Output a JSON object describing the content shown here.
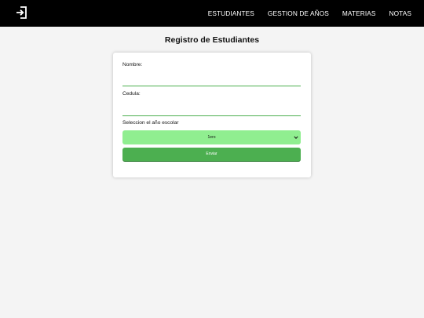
{
  "nav": {
    "logout_icon": "logout-icon",
    "links": [
      "ESTUDIANTES",
      "GESTION DE AÑOS",
      "MATERIAS",
      "NOTAS"
    ]
  },
  "page": {
    "title": "Registro de Estudiantes"
  },
  "form": {
    "nombre_label": "Nombre:",
    "nombre_value": "",
    "cedula_label": "Cedula:",
    "cedula_value": "",
    "year_label": "Seleccion el año escolar",
    "year_selected": "1ero",
    "submit_label": "Enviar"
  },
  "colors": {
    "navbar": "#000000",
    "accent": "#4caf50",
    "select_bg": "#90ee90",
    "page_bg": "#f4f4f4"
  }
}
